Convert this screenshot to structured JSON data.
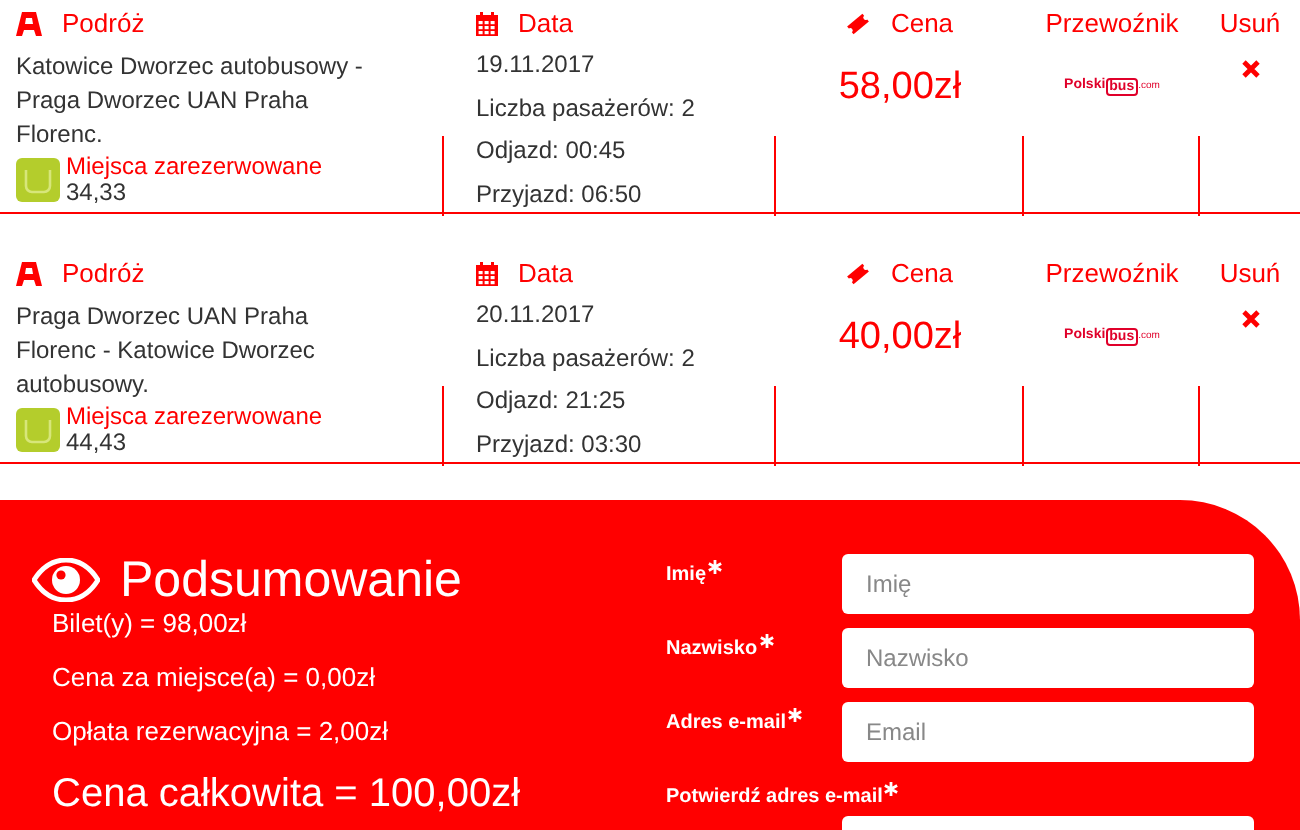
{
  "trips": [
    {
      "headers": {
        "route": "Podróż",
        "date": "Data",
        "price": "Cena",
        "carrier": "Przewoźnik",
        "remove": "Usuń"
      },
      "route": "Katowice Dworzec autobusowy - Praga Dworzec UAN Praha Florenc.",
      "seats_label": "Miejsca zarezerwowane",
      "seats": "34,33",
      "date": "19.11.2017",
      "passengers": "Liczba pasażerów: 2",
      "departure": "Odjazd: 00:45",
      "arrival": "Przyjazd: 06:50",
      "price": "58,00zł",
      "carrier_logo": {
        "name": "Polski",
        "badge": "bus",
        "suffix": ".com"
      }
    },
    {
      "headers": {
        "route": "Podróż",
        "date": "Data",
        "price": "Cena",
        "carrier": "Przewoźnik",
        "remove": "Usuń"
      },
      "route": "Praga Dworzec UAN Praha Florenc - Katowice Dworzec autobusowy.",
      "seats_label": "Miejsca zarezerwowane",
      "seats": "44,43",
      "date": "20.11.2017",
      "passengers": "Liczba pasażerów: 2",
      "departure": "Odjazd: 21:25",
      "arrival": "Przyjazd: 03:30",
      "price": "40,00zł",
      "carrier_logo": {
        "name": "Polski",
        "badge": "bus",
        "suffix": ".com"
      }
    }
  ],
  "summary": {
    "title": "Podsumowanie",
    "lines": [
      "Bilet(y) = 98,00zł",
      "Cena za miejsce(a) = 0,00zł",
      "Opłata rezerwacyjna = 2,00zł"
    ],
    "total": "Cena całkowita = 100,00zł"
  },
  "form": [
    {
      "label": "Imię",
      "required": true,
      "placeholder": "Imię"
    },
    {
      "label": "Nazwisko",
      "required": true,
      "placeholder": "Nazwisko"
    },
    {
      "label": "Adres e-mail",
      "required": true,
      "placeholder": "Email"
    },
    {
      "label": "Potwierdź adres e-mail",
      "required": true
    }
  ]
}
